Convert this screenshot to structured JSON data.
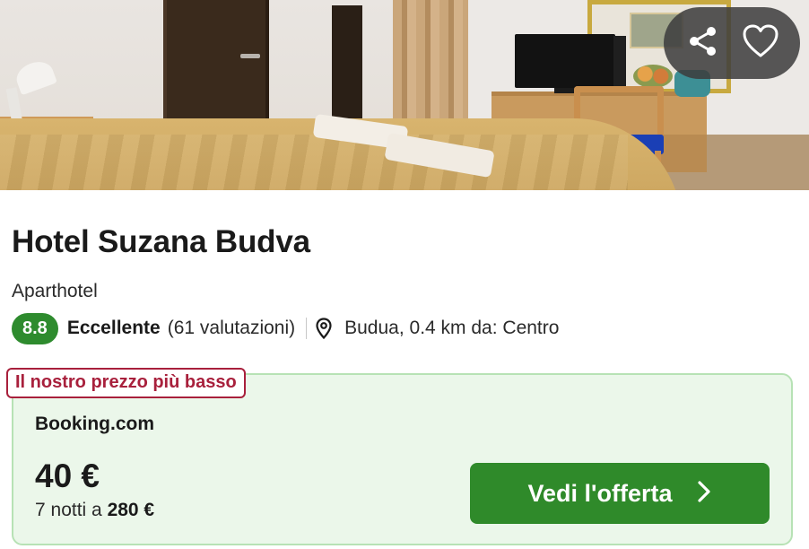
{
  "photo": {
    "share_icon": "share-icon",
    "favorite_icon": "heart-icon",
    "overlay_color": "#3c3c3c"
  },
  "hotel": {
    "name": "Hotel Suzana Budva",
    "type": "Aparthotel",
    "rating": {
      "score": "8.8",
      "label": "Eccellente",
      "reviews": "(61 valutazioni)",
      "badge_color": "#2e8b2e"
    },
    "location": "Budua, 0.4 km da: Centro",
    "location_icon": "map-pin-icon"
  },
  "deal": {
    "badge": "Il nostro prezzo più basso",
    "badge_color": "#a8203c",
    "provider": "Booking.com",
    "price": "40 €",
    "nights_prefix": "7 notti a",
    "total": "280 €",
    "cta_label": "Vedi l'offerta",
    "cta_icon": "chevron-right-icon",
    "cta_color": "#2f8a2a",
    "card_color": "#ebf7ea"
  }
}
